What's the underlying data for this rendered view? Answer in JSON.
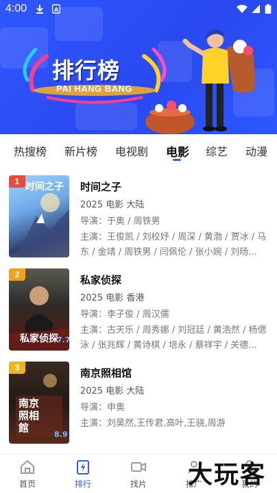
{
  "status_bar": {
    "time": "4:00"
  },
  "banner": {
    "title": "排行榜",
    "subtitle": "PAI HANG BANG"
  },
  "tabs": [
    {
      "label": "热搜榜"
    },
    {
      "label": "新片榜"
    },
    {
      "label": "电视剧"
    },
    {
      "label": "电影"
    },
    {
      "label": "综艺"
    },
    {
      "label": "动漫"
    }
  ],
  "active_tab": "电影",
  "movies": [
    {
      "rank": "1",
      "rank_color": "#e84a3b",
      "title": "时间之子",
      "meta": "2025  电影  大陆",
      "director": "导演：于奥 / 周铁男",
      "cast": "主演：王俊凯 / 刘校妤 / 周深 / 黄渤 / 贾冰 / 马东 / 金靖 / 周铁男 / 闫佩伦 / 张小婉 / 刘旸..."
    },
    {
      "rank": "2",
      "rank_color": "#f3a11b",
      "title": "私家侦探",
      "meta": "2025  电影  香港",
      "director": "导演：李子俊 / 周汉儒",
      "cast": "主演：古天乐 / 周秀娜 / 刘冠廷 / 黄浩然 / 杨偲泳 / 张兆辉 / 黄诗棋 / 培永 / 蔡祥宇 / 关德..."
    },
    {
      "rank": "3",
      "rank_color": "#f2b41d",
      "title": "南京照相馆",
      "meta": "2025  电影  大陆",
      "director": "导演：申奥",
      "cast": "主演：刘昊然,王传君,高叶,王骁,周游"
    }
  ],
  "posters": [
    {
      "text": "时间之子",
      "score": ""
    },
    {
      "text": "私家侦探",
      "score": "7.7"
    },
    {
      "text": "南京照相館",
      "score": "8.9"
    }
  ],
  "nav": [
    {
      "label": "首页"
    },
    {
      "label": "排行"
    },
    {
      "label": "找片"
    },
    {
      "label": "推广"
    },
    {
      "label": "我的"
    }
  ],
  "watermark": "大玩客"
}
